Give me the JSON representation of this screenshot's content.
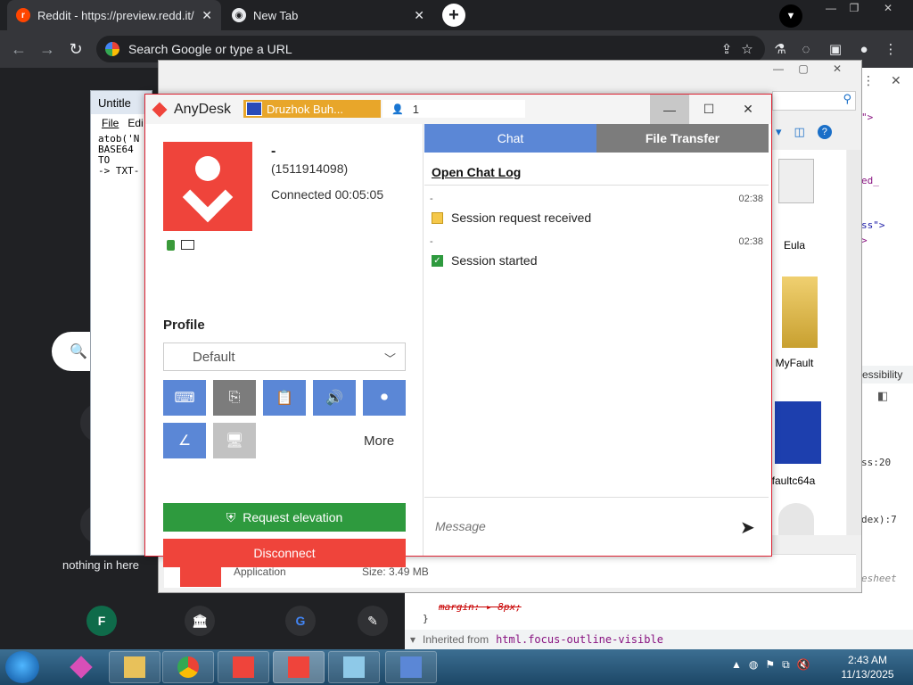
{
  "browser": {
    "tabs": [
      {
        "title": "Reddit - https://preview.redd.it/"
      },
      {
        "title": "New Tab"
      }
    ],
    "omnibox_placeholder": "Search Google or type a URL",
    "ntp": {
      "shortcut_label": "nothing in here",
      "shortcut_letter": "F"
    }
  },
  "notepad": {
    "title": "Untitle",
    "menu": [
      "File",
      "Edi"
    ],
    "lines": [
      "atob('N",
      "BASE64",
      "TO",
      "-> TXT-"
    ]
  },
  "explorer": {
    "files": [
      {
        "name": "Eula"
      },
      {
        "name": "MyFault"
      },
      {
        "name": "yfaultc64a"
      }
    ],
    "bottom_type": "Application",
    "bottom_size": "Size: 3.49 MB"
  },
  "devtools": {
    "snippets": [
      "\">",
      "ed_",
      "ss\">",
      ">",
      "essibility",
      "ss:20",
      "dex):7",
      "esheet",
      "margin: ▸ 8px;",
      "}",
      "Inherited from",
      "html.focus-outline-visible"
    ]
  },
  "anydesk": {
    "app_name": "AnyDesk",
    "remote_tab": "Druzhok Buh...",
    "users_count": "1",
    "connection": {
      "name": "-",
      "id": "(1511914098)",
      "status": "Connected 00:05:05"
    },
    "profile_label": "Profile",
    "profile_value": "Default",
    "more_label": "More",
    "request_elevation": "Request elevation",
    "disconnect": "Disconnect",
    "chat_tab": "Chat",
    "file_transfer_tab": "File Transfer",
    "open_chat_log": "Open Chat Log",
    "messages": [
      {
        "sender": "-",
        "time": "02:38",
        "text": "Session request received",
        "icon": "info-icon"
      },
      {
        "sender": "-",
        "time": "02:38",
        "text": "Session started",
        "icon": "check-icon"
      }
    ],
    "message_placeholder": "Message"
  },
  "taskbar": {
    "time": "2:43 AM",
    "date": "11/13/2025"
  }
}
